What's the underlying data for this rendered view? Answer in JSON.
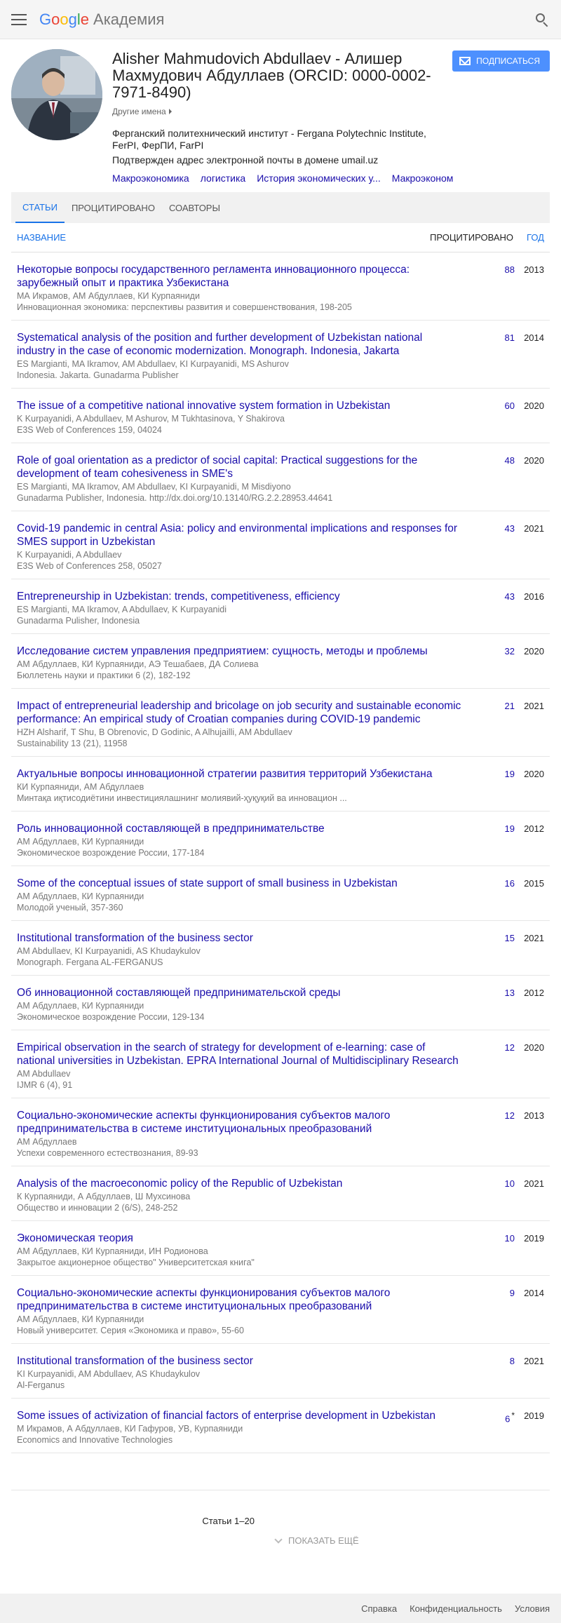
{
  "header": {
    "logo_parts": [
      "G",
      "o",
      "o",
      "g",
      "l",
      "e"
    ],
    "product": "Академия"
  },
  "profile": {
    "name": "Alisher Mahmudovich Abdullaev - Алишер Махмудович Абдуллаев (ORCID: 0000-0002-7971-8490)",
    "other_names": "Другие имена",
    "affiliation": "Ферганский политехнический институт - Fergana Polytechnic Institute, FerPI, ФерПИ, FarPI",
    "email_note": "Подтвержден адрес электронной почты в домене umail.uz",
    "interests": [
      "Макроэкономика",
      "логистика",
      "История экономических у...",
      "Макроэконом"
    ],
    "subscribe": "ПОДПИСАТЬСЯ"
  },
  "tabs": [
    "СТАТЬИ",
    "ПРОЦИТИРОВАНО",
    "СОАВТОРЫ"
  ],
  "table": {
    "col_title": "НАЗВАНИЕ",
    "col_cited": "ПРОЦИТИРОВАНО",
    "col_year": "ГОД",
    "rows": [
      {
        "title": "Некоторые вопросы государственного регламента инновационного процесса: зарубежный опыт и практика Узбекистана",
        "authors": "МА Икрамов, АМ Абдуллаев, КИ Курпаяниди",
        "venue": "Инновационная экономика: перспективы развития и совершенствования, 198-205",
        "cited": "88",
        "year": "2013"
      },
      {
        "title": "Systematical analysis of the position and further development of Uzbekistan national industry in the case of economic modernization. Monograph. Indonesia, Jakarta",
        "authors": "ES Margianti, MA Ikramov, AM Abdullaev, KI Kurpayanidi, MS Ashurov",
        "venue": "Indonesia. Jakarta. Gunadarma Publisher",
        "cited": "81",
        "year": "2014"
      },
      {
        "title": "The issue of a competitive national innovative system formation in Uzbekistan",
        "authors": "K Kurpayanidi, A Abdullaev, M Ashurov, M Tukhtasinova, Y Shakirova",
        "venue": "E3S Web of Conferences 159, 04024",
        "cited": "60",
        "year": "2020"
      },
      {
        "title": "Role of goal orientation as a predictor of social capital: Practical suggestions for the development of team cohesiveness in SME's",
        "authors": "ES Margianti, MA Ikramov, AM Abdullaev, KI Kurpayanidi, M Misdiyono",
        "venue": "Gunadarma Publisher, Indonesia. http://dx.doi.org/10.13140/RG.2.2.28953.44641",
        "cited": "48",
        "year": "2020"
      },
      {
        "title": "Covid-19 pandemic in central Asia: policy and environmental implications and responses for SMES support in Uzbekistan",
        "authors": "K Kurpayanidi, A Abdullaev",
        "venue": "E3S Web of Conferences 258, 05027",
        "cited": "43",
        "year": "2021"
      },
      {
        "title": "Entrepreneurship in Uzbekistan: trends, competitiveness, efficiency",
        "authors": "ES Margianti, MA Ikramov, A Abdullaev, K Kurpayanidi",
        "venue": "Gunadarma Pulisher, Indonesia",
        "cited": "43",
        "year": "2016"
      },
      {
        "title": "Исследование систем управления предприятием: сущность, методы и проблемы",
        "authors": "АМ Абдуллаев, КИ Курпаяниди, АЭ Тешабаев, ДА Солиева",
        "venue": "Бюллетень науки и практики 6 (2), 182-192",
        "cited": "32",
        "year": "2020"
      },
      {
        "title": "Impact of entrepreneurial leadership and bricolage on job security and sustainable economic performance: An empirical study of Croatian companies during COVID-19 pandemic",
        "authors": "HZH Alsharif, T Shu, B Obrenovic, D Godinic, A Alhujailli, AM Abdullaev",
        "venue": "Sustainability 13 (21), 11958",
        "cited": "21",
        "year": "2021"
      },
      {
        "title": "Актуальные вопросы инновационной стратегии развития территорий Узбекистана",
        "authors": "КИ Курпаяниди, АМ Абдуллаев",
        "venue": "Минтақа иқтисодиётини инвестициялашнинг молиявий-ҳуқуқий ва инновацион ...",
        "cited": "19",
        "year": "2020"
      },
      {
        "title": "Роль инновационной составляющей в предпринимательстве",
        "authors": "АМ Абдуллаев, КИ Курпаяниди",
        "venue": "Экономическое возрождение России, 177-184",
        "cited": "19",
        "year": "2012"
      },
      {
        "title": "Some of the conceptual issues of state support of small business in Uzbekistan",
        "authors": "АМ Абдуллаев, КИ Курпаяниди",
        "venue": "Молодой ученый, 357-360",
        "cited": "16",
        "year": "2015"
      },
      {
        "title": "Institutional transformation of the business sector",
        "authors": "AM Abdullaev, KI Kurpayanidi, AS Khudaykulov",
        "venue": "Monograph. Fergana AL-FERGANUS",
        "cited": "15",
        "year": "2021"
      },
      {
        "title": "Об инновационной составляющей предпринимательской среды",
        "authors": "АМ Абдуллаев, КИ Курпаяниди",
        "venue": "Экономическое возрождение России, 129-134",
        "cited": "13",
        "year": "2012"
      },
      {
        "title": "Empirical observation in the search of strategy for development of e-learning: case of national universities in Uzbekistan. EPRA International Journal of Multidisciplinary Research",
        "authors": "AM Abdullaev",
        "venue": "IJMR 6 (4), 91",
        "cited": "12",
        "year": "2020"
      },
      {
        "title": "Социально-экономические аспекты функционирования субъектов малого предпринимательства в системе институциональных преобразований",
        "authors": "АМ Абдуллаев",
        "venue": "Успехи современного естествознания, 89-93",
        "cited": "12",
        "year": "2013"
      },
      {
        "title": "Analysis of the macroeconomic policy of the Republic of Uzbekistan",
        "authors": "К Курпаяниди, А Абдуллаев, Ш Мухсинова",
        "venue": "Общество и инновации 2 (6/S), 248-252",
        "cited": "10",
        "year": "2021"
      },
      {
        "title": "Экономическая теория",
        "authors": "АМ Абдуллаев, КИ Курпаяниди, ИН Родионова",
        "venue": "Закрытое акционерное общество\" Университетская книга\"",
        "cited": "10",
        "year": "2019"
      },
      {
        "title": "Социально-экономические аспекты функционирования субъектов малого предпринимательства в системе институциональных преобразований",
        "authors": "АМ Абдуллаев, КИ Курпаяниди",
        "venue": "Новый университет. Серия «Экономика и право», 55-60",
        "cited": "9",
        "year": "2014"
      },
      {
        "title": "Institutional transformation of the business sector",
        "authors": "KI Kurpayanidi, AM Abdullaev, AS Khudaykulov",
        "venue": "Al-Ferganus",
        "cited": "8",
        "year": "2021"
      },
      {
        "title": "Some issues of activization of financial factors of enterprise development in Uzbekistan",
        "authors": "М Икрамов, А Абдуллаев, КИ Гафуров, УВ, Курпаяниди",
        "venue": "Economics and Innovative Technologies",
        "cited": "6",
        "year": "2019",
        "star": "*"
      }
    ]
  },
  "pagination": {
    "range": "Статьи 1–20",
    "show_more": "ПОКАЗАТЬ ЕЩЁ"
  },
  "footer": [
    "Справка",
    "Конфиденциальность",
    "Условия"
  ]
}
